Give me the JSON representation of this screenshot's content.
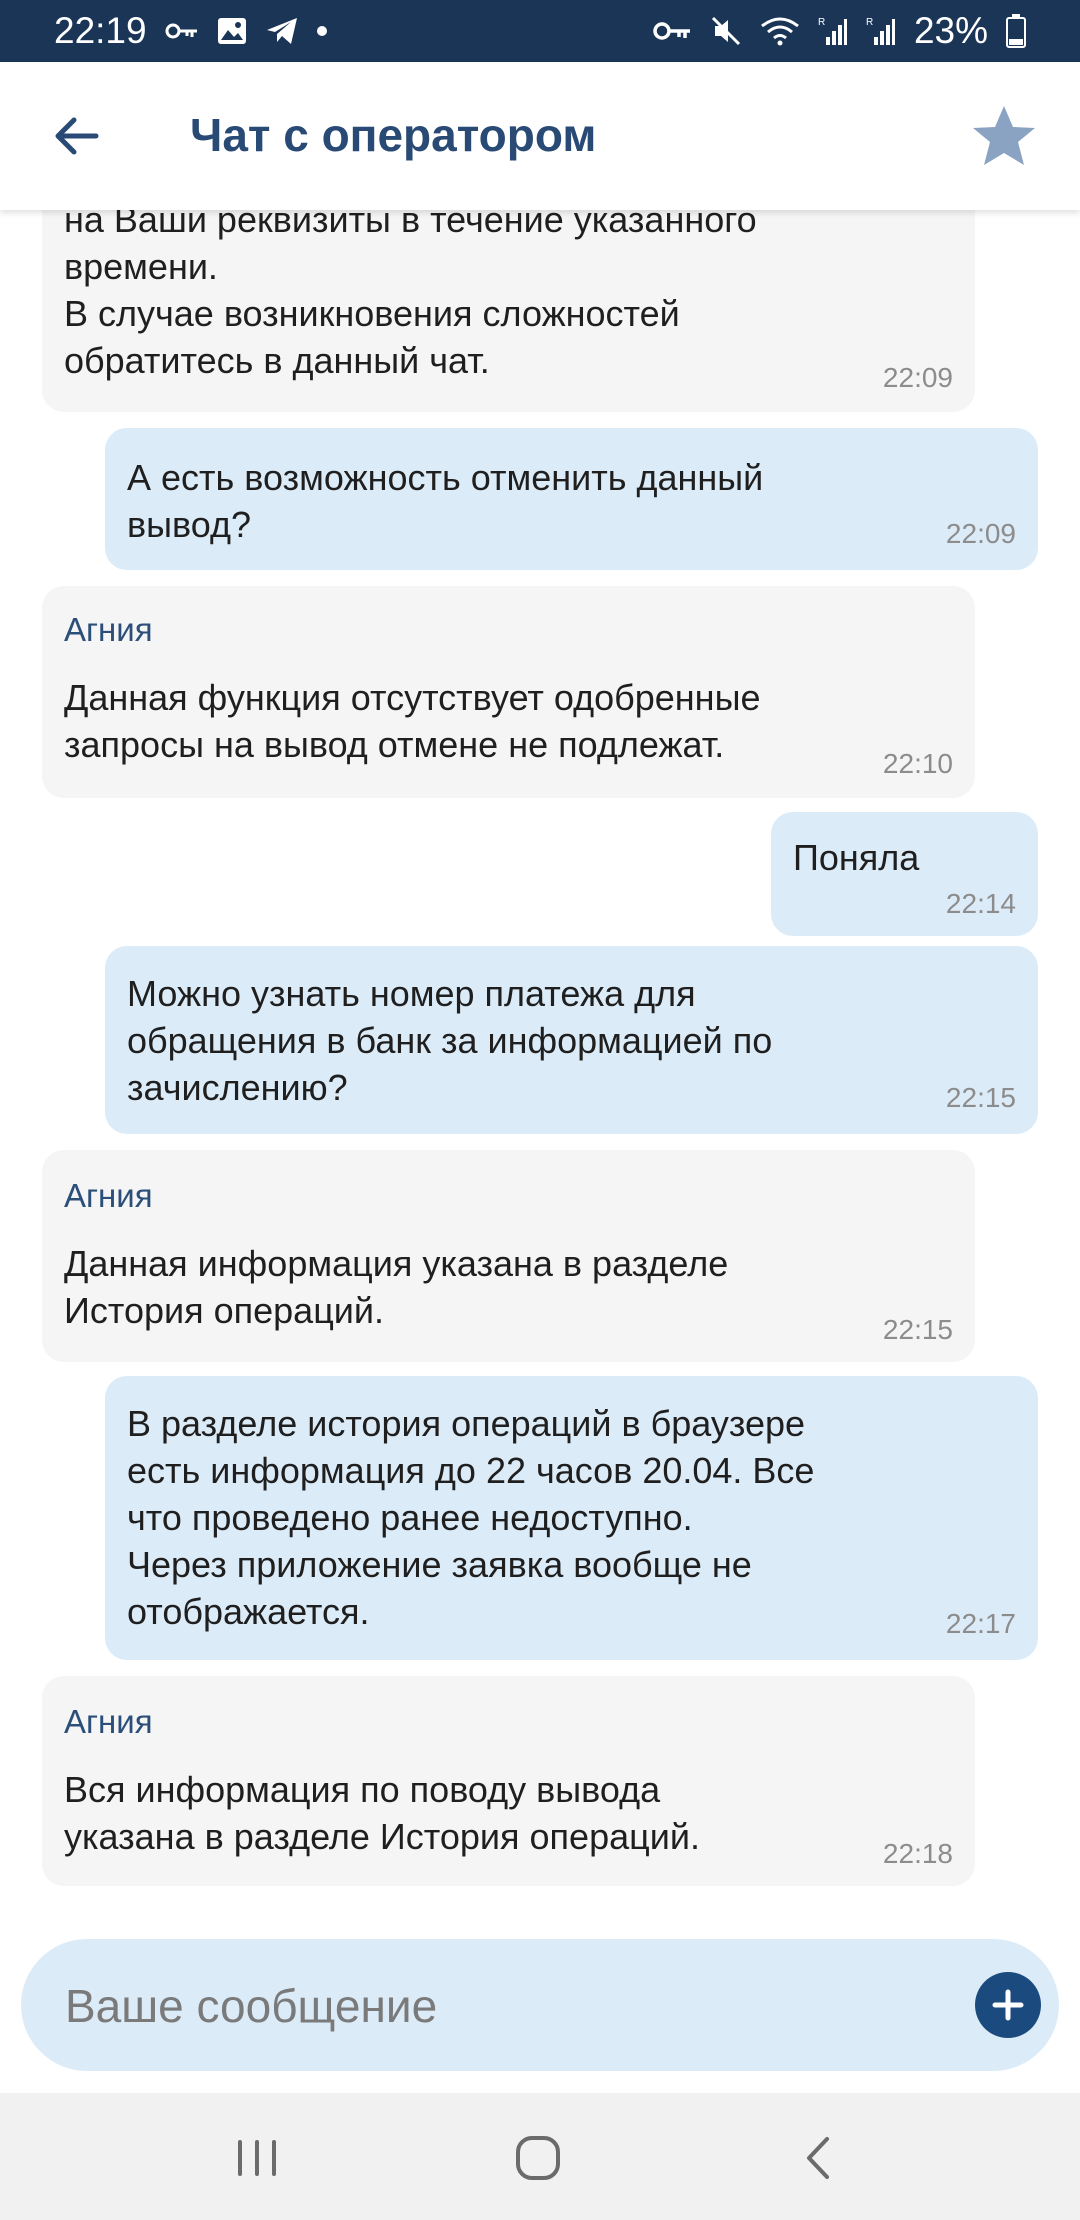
{
  "status_bar": {
    "time": "22:19",
    "battery": "23%",
    "left_icons": [
      "key-icon",
      "image-icon",
      "telegram-icon",
      "dot-icon"
    ],
    "right_icons": [
      "vpn-key-icon",
      "mute-icon",
      "wifi-icon",
      "signal-icon",
      "signal-icon",
      "battery-icon"
    ]
  },
  "header": {
    "title": "Чат с оператором"
  },
  "colors": {
    "status_bar_bg": "#1b3557",
    "accent": "#284a74",
    "operator_bubble": "#f5f5f5",
    "user_bubble": "#dcebf8",
    "star": "#8aa3c2"
  },
  "messages": [
    {
      "from": "operator",
      "author": "",
      "text": "на Ваши реквизиты в течение указанного\nвремени.\nВ случае возникновения сложностей\nобратитесь в данный чат.",
      "time": "22:09"
    },
    {
      "from": "user",
      "text": "А есть возможность отменить данный\nвывод?",
      "time": "22:09"
    },
    {
      "from": "operator",
      "author": "Агния",
      "text": "Данная функция отсутствует одобренные\nзапросы на вывод отмене не подлежат.",
      "time": "22:10"
    },
    {
      "from": "user",
      "text": "Поняла",
      "time": "22:14"
    },
    {
      "from": "user",
      "text": "Можно узнать номер платежа для\nобращения в банк за информацией по\nзачислению?",
      "time": "22:15"
    },
    {
      "from": "operator",
      "author": "Агния",
      "text": "Данная информация указана в разделе\nИстория операций.",
      "time": "22:15"
    },
    {
      "from": "user",
      "text": "В разделе история операций в браузере\nесть информация до 22 часов 20.04. Все\nчто проведено ранее недоступно.\nЧерез приложение заявка вообще не\nотображается.",
      "time": "22:17"
    },
    {
      "from": "operator",
      "author": "Агния",
      "text": "Вся информация по поводу вывода\nуказана в разделе История операций.",
      "time": "22:18"
    }
  ],
  "input": {
    "placeholder": "Ваше сообщение"
  }
}
